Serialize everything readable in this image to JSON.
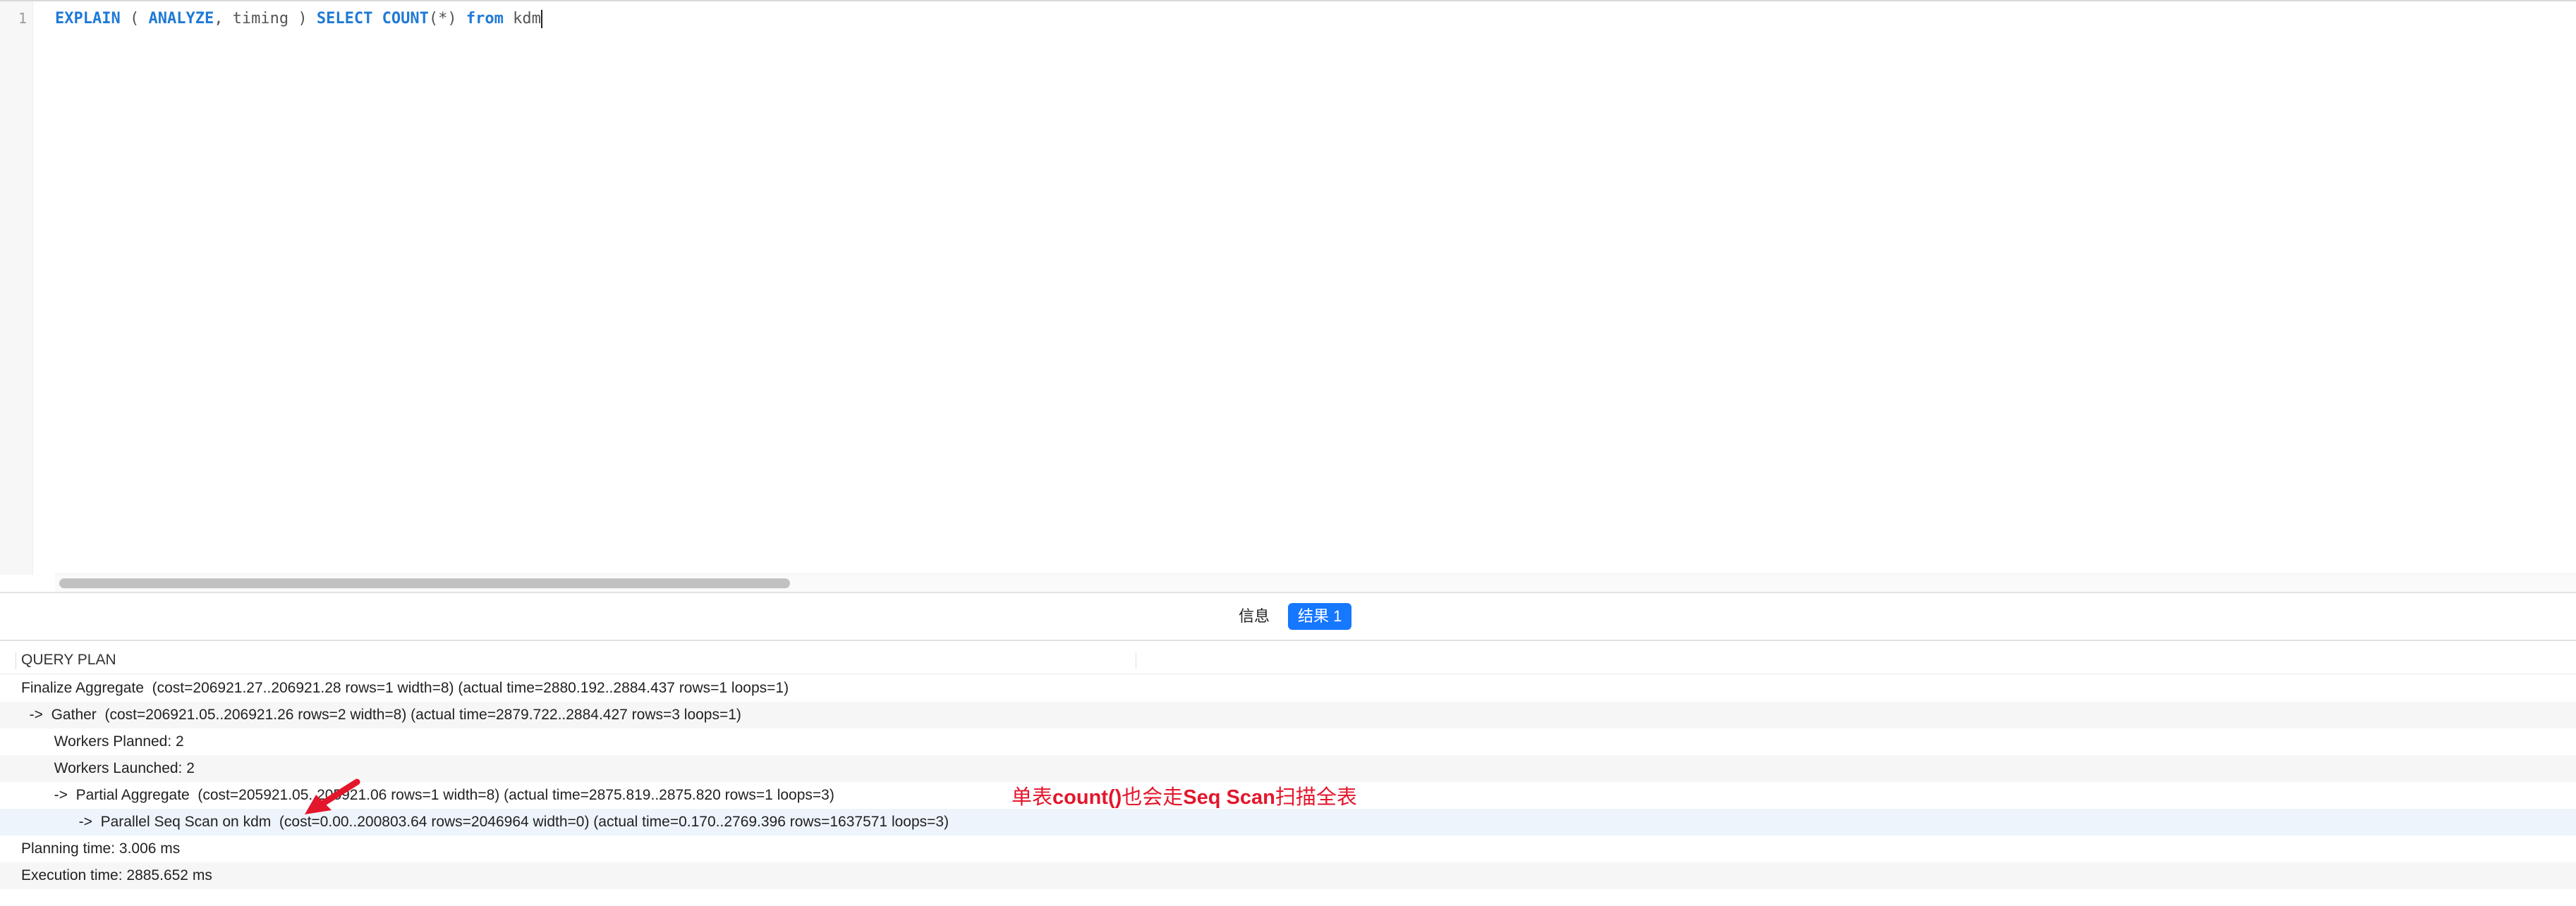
{
  "editor": {
    "line_number": "1",
    "tokens": {
      "explain": "EXPLAIN",
      "paren_open": " ( ",
      "analyze": "ANALYZE",
      "comma_timing": ", timing ) ",
      "select": "SELECT",
      "space1": " ",
      "count": "COUNT",
      "star": "(*)",
      "space2": " ",
      "from": "from",
      "table": " kdm"
    }
  },
  "tabs": {
    "info": "信息",
    "result": "结果 1"
  },
  "grid": {
    "column_header": "QUERY PLAN",
    "rows": [
      "Finalize Aggregate  (cost=206921.27..206921.28 rows=1 width=8) (actual time=2880.192..2884.437 rows=1 loops=1)",
      "  ->  Gather  (cost=206921.05..206921.26 rows=2 width=8) (actual time=2879.722..2884.427 rows=3 loops=1)",
      "        Workers Planned: 2",
      "        Workers Launched: 2",
      "        ->  Partial Aggregate  (cost=205921.05..205921.06 rows=1 width=8) (actual time=2875.819..2875.820 rows=1 loops=3)",
      "              ->  Parallel Seq Scan on kdm  (cost=0.00..200803.64 rows=2046964 width=0) (actual time=0.170..2769.396 rows=1637571 loops=3)",
      "Planning time: 3.006 ms",
      "Execution time: 2885.652 ms"
    ]
  },
  "annotation": {
    "part1": "单表",
    "part2": "count()",
    "part3": "也会走",
    "part4": "Seq Scan",
    "part5": "扫描全表",
    "color": "#e3162c"
  }
}
